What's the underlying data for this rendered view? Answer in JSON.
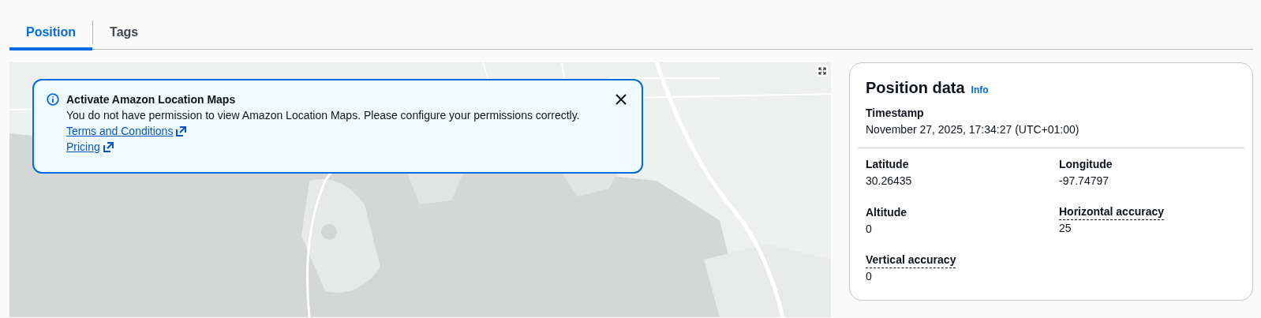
{
  "tabs": [
    {
      "label": "Position",
      "selected": true
    },
    {
      "label": "Tags",
      "selected": false
    }
  ],
  "map": {
    "alert": {
      "title": "Activate Amazon Location Maps",
      "message": "You do not have permission to view Amazon Location Maps. Please configure your permissions correctly.",
      "links": [
        "Terms and Conditions",
        "Pricing"
      ]
    }
  },
  "position_data": {
    "title": "Position data",
    "info": "Info",
    "timestamp": {
      "label": "Timestamp",
      "value": "November 27, 2025, 17:34:27 (UTC+01:00)"
    },
    "fields": [
      {
        "label": "Latitude",
        "value": "30.26435",
        "kind": "plain"
      },
      {
        "label": "Longitude",
        "value": "-97.74797",
        "kind": "plain"
      },
      {
        "label": "Altitude",
        "value": "0",
        "kind": "plain"
      },
      {
        "label": "Horizontal accuracy",
        "value": "25",
        "kind": "popover"
      },
      {
        "label": "Vertical accuracy",
        "value": "0",
        "kind": "popover"
      }
    ]
  }
}
